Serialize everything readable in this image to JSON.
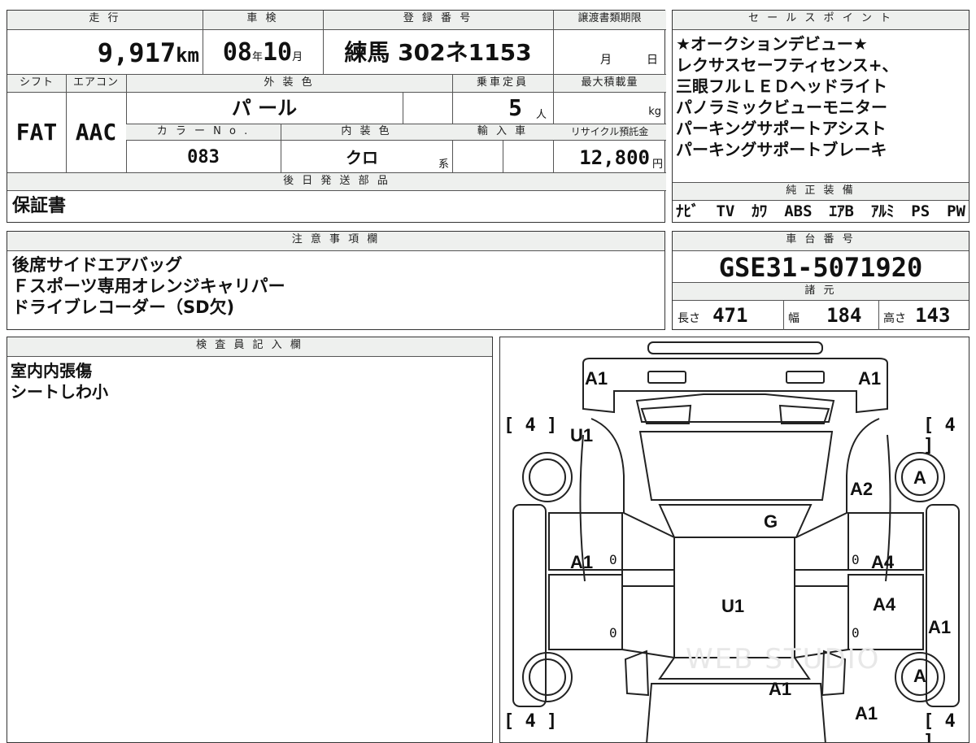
{
  "vehicle": {
    "mileage_label": "走 行",
    "mileage": "9,917",
    "mileage_unit": "km",
    "inspection_label": "車 検",
    "inspection_year": "08",
    "year_unit": "年",
    "inspection_month": "10",
    "month_unit": "月",
    "registration_label": "登 録 番 号",
    "registration": "練馬 302ネ1153",
    "transfer_deadline_label": "譲渡書類期限",
    "transfer_month_unit": "月",
    "transfer_day_unit": "日",
    "shift_label": "シフト",
    "shift": "FAT",
    "aircon_label": "エアコン",
    "aircon": "AAC",
    "exterior_color_label": "外 装 色",
    "exterior_color": "パ ール",
    "capacity_label": "乗車定員",
    "capacity": "5",
    "capacity_unit": "人",
    "max_load_label": "最大積載量",
    "max_load_unit": "kg",
    "color_no_label": "カ ラ ー N o .",
    "color_no": "083",
    "interior_color_label": "内 装 色",
    "interior_color": "クロ",
    "interior_suffix": "系",
    "import_label": "輸 入 車",
    "recycle_label": "リサイクル預託金",
    "recycle_fee": "12,800",
    "recycle_unit": "円",
    "later_parts_label": "後 日 発 送 部 品",
    "later_parts": "保証書"
  },
  "sales_points": {
    "label": "セ ー ル ス ポ イ ン ト",
    "lines": [
      "★オークションデビュー★",
      "レクサスセーフティセンス+、",
      "三眼フルＬＥＤヘッドライト",
      "パノラミックビューモニター",
      "パーキングサポートアシスト",
      "パーキングサポートブレーキ"
    ]
  },
  "equipment": {
    "label": "純 正 装 備",
    "items": [
      "ﾅﾋﾞ",
      "TV",
      "ｶﾜ",
      "ABS",
      "ｴｱB",
      "ｱﾙﾐ",
      "PS",
      "PW"
    ]
  },
  "notes": {
    "label": "注 意 事 項 欄",
    "lines": [
      "後席サイドエアバッグ",
      "Ｆスポーツ専用オレンジキャリパー",
      "ドライブレコーダー（SD欠)"
    ]
  },
  "chassis": {
    "label": "車 台 番 号",
    "number": "GSE31-5071920",
    "spec_label": "諸 元",
    "length_label": "長さ",
    "length": "471",
    "width_label": "幅",
    "width": "184",
    "height_label": "高さ",
    "height": "143"
  },
  "inspector": {
    "label": "検 査 員 記 入 欄",
    "lines": [
      "室内内張傷",
      "シートしわ小"
    ]
  },
  "diagram": {
    "marks": {
      "front_left": "A1",
      "front_right": "A1",
      "left_front": "U1",
      "right_front": "A2",
      "tire_right_front": "A",
      "hood": "G",
      "left_door_front": "A1",
      "right_door_front": "A4",
      "roof": "U1",
      "right_door_rear": "A4",
      "right_rear_edge": "A1",
      "tire_right_rear": "A",
      "trunk": "A1",
      "rear_right": "A1"
    },
    "tread": [
      "4",
      "4",
      "4",
      "4"
    ],
    "zero": "0",
    "watermark": "WEB STUDIO"
  }
}
